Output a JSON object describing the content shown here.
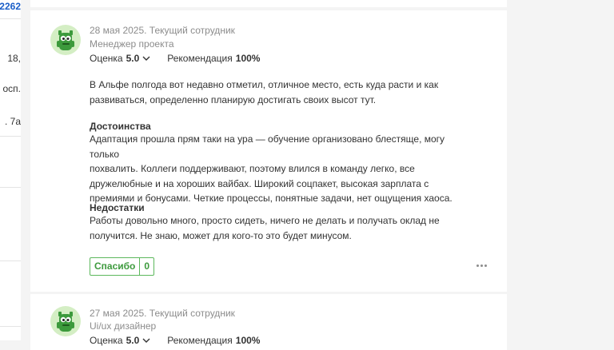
{
  "left_column": {
    "fragments": [
      "2262",
      "18,",
      "осп.",
      ". 7а"
    ]
  },
  "reviews": [
    {
      "date_status": "28 мая 2025. Текущий сотрудник",
      "position": "Менеджер проекта",
      "rating_label": "Оценка",
      "rating_value": "5.0",
      "recommendation_label": "Рекомендация",
      "recommendation_value": "100%",
      "summary_lines": [
        "В Альфе полгода вот недавно отметил, отличное место, есть куда расти и как",
        "развиваться, определенно планирую достигать своих высот тут."
      ],
      "pros_title": "Достоинства",
      "pros_lines": [
        "Адаптация прошла прям таки на ура — обучение организовано блестяще, могу только",
        "похвалить. Коллеги поддерживают, поэтому влился в команду легко, все",
        "дружелюбные и на хороших вайбах. Широкий соцпакет, высокая зарплата с",
        "премиями и бонусами. Четкие процессы, понятные задачи, нет ощущения хаоса."
      ],
      "cons_title": "Недостатки",
      "cons_lines": [
        "Работы довольно много, просто сидеть, ничего не делать и получать оклад не",
        "получится. Не знаю, может для кого-то это будет минусом."
      ],
      "thanks_label": "Спасибо",
      "thanks_count": "0"
    },
    {
      "date_status": "27 мая 2025. Текущий сотрудник",
      "position": "Ui/ux дизайнер",
      "rating_label": "Оценка",
      "rating_value": "5.0",
      "recommendation_label": "Рекомендация",
      "recommendation_value": "100%"
    }
  ],
  "colors": {
    "page_bg": "#f4f4f4",
    "link_blue": "#1a5ec8",
    "thanks_green": "#5cb85c",
    "muted_text": "#8c8c8c"
  },
  "icons": [
    "avatar-green-monster",
    "chevron-down-icon",
    "more-dots-icon"
  ]
}
